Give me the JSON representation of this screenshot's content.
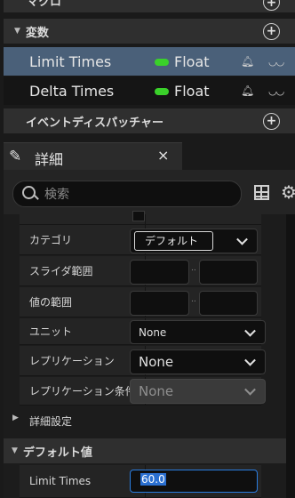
{
  "top_section": {
    "title": "マクロ"
  },
  "variables_section": {
    "title": "変数"
  },
  "variables": [
    {
      "name": "Limit Times",
      "type": "Float"
    },
    {
      "name": "Delta Times",
      "type": "Float"
    }
  ],
  "dispatchers_section": {
    "title": "イベントディスパッチャー"
  },
  "details_tab": {
    "title": "詳細",
    "close": "×"
  },
  "search": {
    "placeholder": "検索"
  },
  "properties": {
    "category": {
      "label": "カテゴリ",
      "value": "デフォルト"
    },
    "slider_range": {
      "label": "スライダ範囲",
      "separator": ".."
    },
    "value_range": {
      "label": "値の範囲",
      "separator": ".."
    },
    "units": {
      "label": "ユニット",
      "value": "None"
    },
    "replication": {
      "label": "レプリケーション",
      "value": "None"
    },
    "replication_condition": {
      "label": "レプリケーション条件",
      "value": "None"
    }
  },
  "advanced": {
    "label": "詳細設定"
  },
  "default_value_section": {
    "title": "デフォルト値"
  },
  "default_value": {
    "label": "Limit Times",
    "value": "60.0"
  },
  "colors": {
    "selected_row": "#4a6079",
    "float_pill": "#3ad12a",
    "accent": "#2a7de1"
  }
}
